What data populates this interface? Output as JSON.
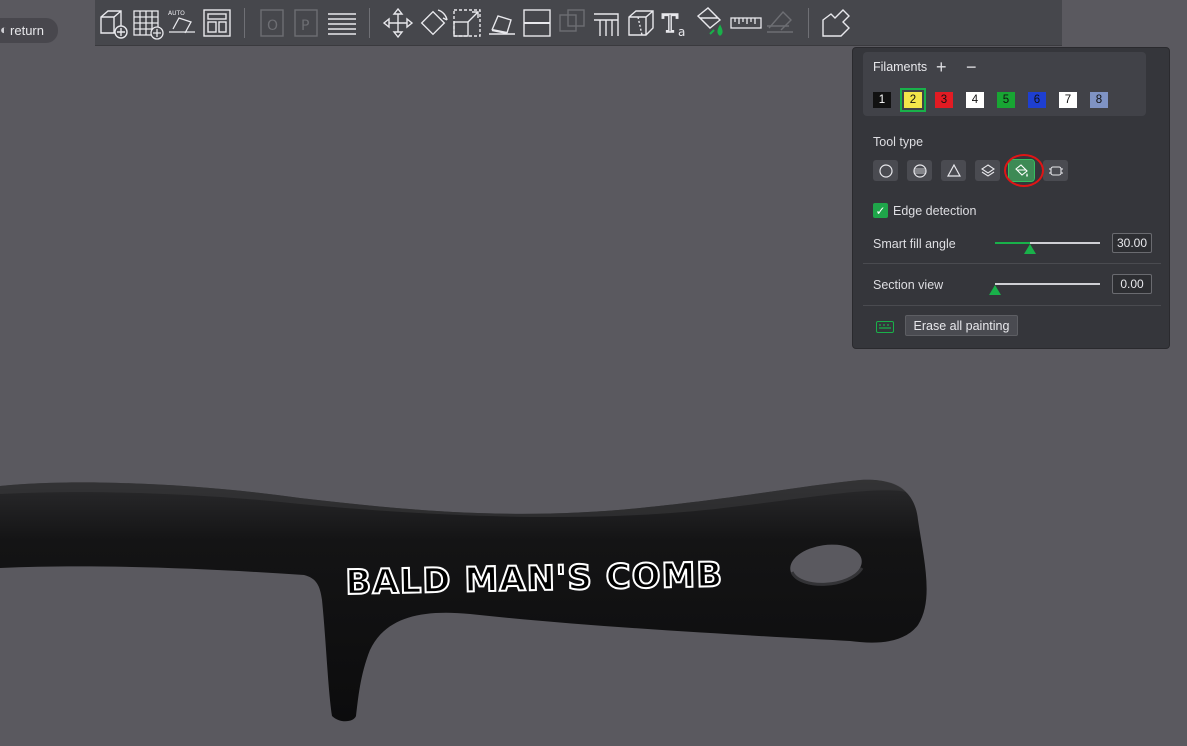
{
  "app": {
    "return_label": "return",
    "accent_color": "#19b14a",
    "panel_bg": "#35363b",
    "viewport_bg": "#5a595f"
  },
  "toolbar": {
    "buttons": [
      {
        "icon": "add-object-icon",
        "enabled": true
      },
      {
        "icon": "add-plate-icon",
        "enabled": true
      },
      {
        "icon": "auto-orient-icon",
        "enabled": true
      },
      {
        "icon": "arrange-icon",
        "enabled": true
      },
      {
        "icon": "split-objects-icon",
        "enabled": false
      },
      {
        "icon": "split-parts-icon",
        "enabled": false
      },
      {
        "icon": "layers-icon",
        "enabled": true
      },
      {
        "icon": "move-icon",
        "enabled": true
      },
      {
        "icon": "rotate-icon",
        "enabled": true
      },
      {
        "icon": "scale-icon",
        "enabled": true
      },
      {
        "icon": "lay-on-face-icon",
        "enabled": true
      },
      {
        "icon": "cut-icon",
        "enabled": true
      },
      {
        "icon": "boolean-icon",
        "enabled": false
      },
      {
        "icon": "support-painting-icon",
        "enabled": true
      },
      {
        "icon": "seam-painting-icon",
        "enabled": true
      },
      {
        "icon": "text-emboss-icon",
        "enabled": true
      },
      {
        "icon": "color-painting-icon",
        "enabled": true,
        "active": true
      },
      {
        "icon": "measure-icon",
        "enabled": true
      },
      {
        "icon": "assembly-icon",
        "enabled": false
      },
      {
        "icon": "variable-layer-height-icon",
        "enabled": true
      }
    ]
  },
  "model": {
    "label": "BALD MAN'S COMB"
  },
  "panel": {
    "filaments": {
      "title": "Filaments",
      "add_label": "+",
      "remove_label": "−",
      "selected": "2",
      "swatches": [
        {
          "label": "1",
          "bg": "#111111",
          "fg": "#ffffff"
        },
        {
          "label": "2",
          "bg": "#f4e64a",
          "fg": "#111111"
        },
        {
          "label": "3",
          "bg": "#e31b23",
          "fg": "#111111"
        },
        {
          "label": "4",
          "bg": "#ffffff",
          "fg": "#111111"
        },
        {
          "label": "5",
          "bg": "#18a533",
          "fg": "#111111"
        },
        {
          "label": "6",
          "bg": "#1e3fd1",
          "fg": "#111111"
        },
        {
          "label": "7",
          "bg": "#ffffff",
          "fg": "#111111"
        },
        {
          "label": "8",
          "bg": "#7f93c4",
          "fg": "#111111"
        }
      ]
    },
    "tool_type": {
      "title": "Tool type",
      "tools": [
        {
          "icon": "circle-brush-icon"
        },
        {
          "icon": "sphere-brush-icon"
        },
        {
          "icon": "triangle-brush-icon"
        },
        {
          "icon": "height-range-icon"
        },
        {
          "icon": "fill-bucket-icon",
          "active": true
        },
        {
          "icon": "gap-fill-icon"
        }
      ]
    },
    "edge_detection": {
      "label": "Edge detection",
      "checked": true
    },
    "smart_fill": {
      "label": "Smart fill angle",
      "value": "30.00",
      "fraction": 0.33
    },
    "section_view": {
      "label": "Section view",
      "value": "0.00",
      "fraction": 0.0
    },
    "erase_label": "Erase all painting"
  }
}
